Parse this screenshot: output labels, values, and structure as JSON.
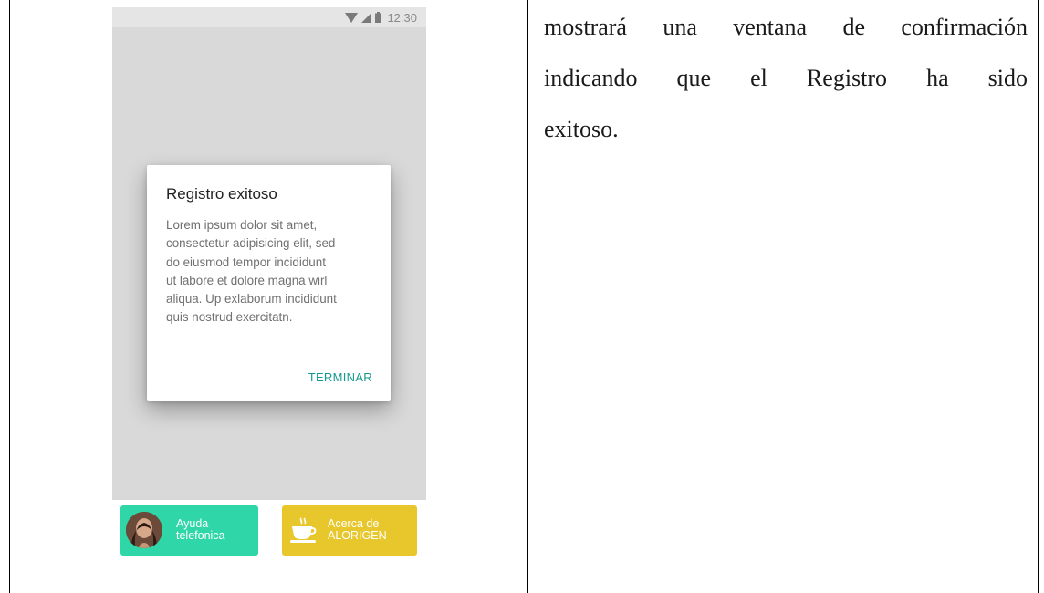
{
  "phone": {
    "status_bar": {
      "time": "12:30"
    },
    "dialog": {
      "title": "Registro exitoso",
      "body_lines": [
        "Lorem ipsum dolor sit amet,",
        "consectetur adipisicing elit, sed",
        "do eiusmod tempor incididunt",
        "ut labore et dolore magna wirl",
        "aliqua. Up exlaborum incididunt",
        "quis nostrud exercitatn."
      ],
      "button": "TERMINAR"
    },
    "bottom_bar": {
      "help": {
        "line1": "Ayuda",
        "line2": "telefonica",
        "color": "#2fd6a7",
        "icon": "avatar"
      },
      "about": {
        "line1": "Acerca de",
        "line2": "ALORIGEN",
        "color": "#e7c72b",
        "icon": "coffee-cup-icon"
      }
    },
    "accent_color": "#14998f"
  },
  "document": {
    "lines": [
      "mostrará una ventana de confirmación",
      "indicando que el Registro ha sido",
      "exitoso."
    ]
  }
}
